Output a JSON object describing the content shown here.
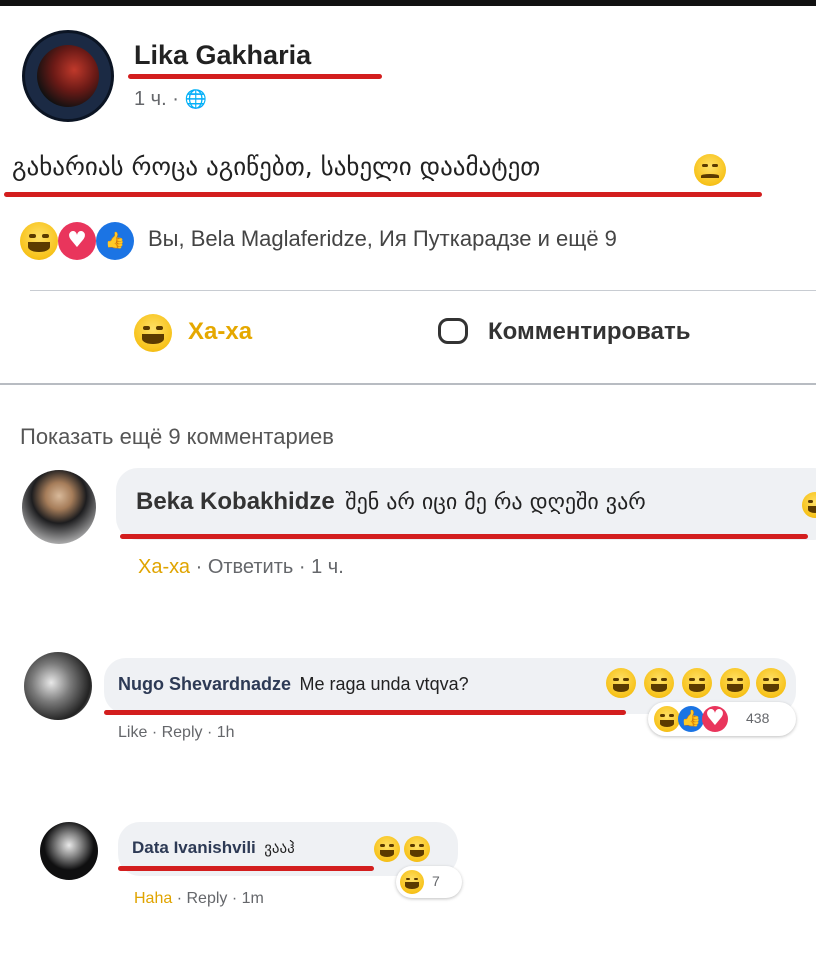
{
  "post": {
    "author": "Lika Gakharia",
    "time": "1 ч.",
    "text": "გახარიას როცა აგიწებთ, სახელი დაამატეთ",
    "reactions_text": "Вы, Bela Maglaferidze, Ия Путкарадзе и ещё 9"
  },
  "actions": {
    "haha_label": "Ха-ха",
    "comment_label": "Комментировать"
  },
  "show_more": "Показать ещё 9 комментариев",
  "comments": [
    {
      "author": "Beka Kobakhidze",
      "text": "შენ არ იცი მე რა დღეში ვარ",
      "haha": "Ха-ха",
      "reply": "Ответить",
      "time": "1 ч."
    },
    {
      "author": "Nugo Shevardnadze",
      "text": "Me raga unda vtqva?",
      "like": "Like",
      "reply": "Reply",
      "time": "1h",
      "reaction_count": "438"
    },
    {
      "author": "Data Ivanishvili",
      "text": "ვააჰ",
      "haha": "Haha",
      "reply": "Reply",
      "time": "1m",
      "reaction_count": "7"
    }
  ],
  "colors": {
    "underline": "#d31e1e",
    "link_blue": "#1b74e4",
    "haha_yellow": "#f7c21a",
    "bubble": "#eff1f4"
  }
}
